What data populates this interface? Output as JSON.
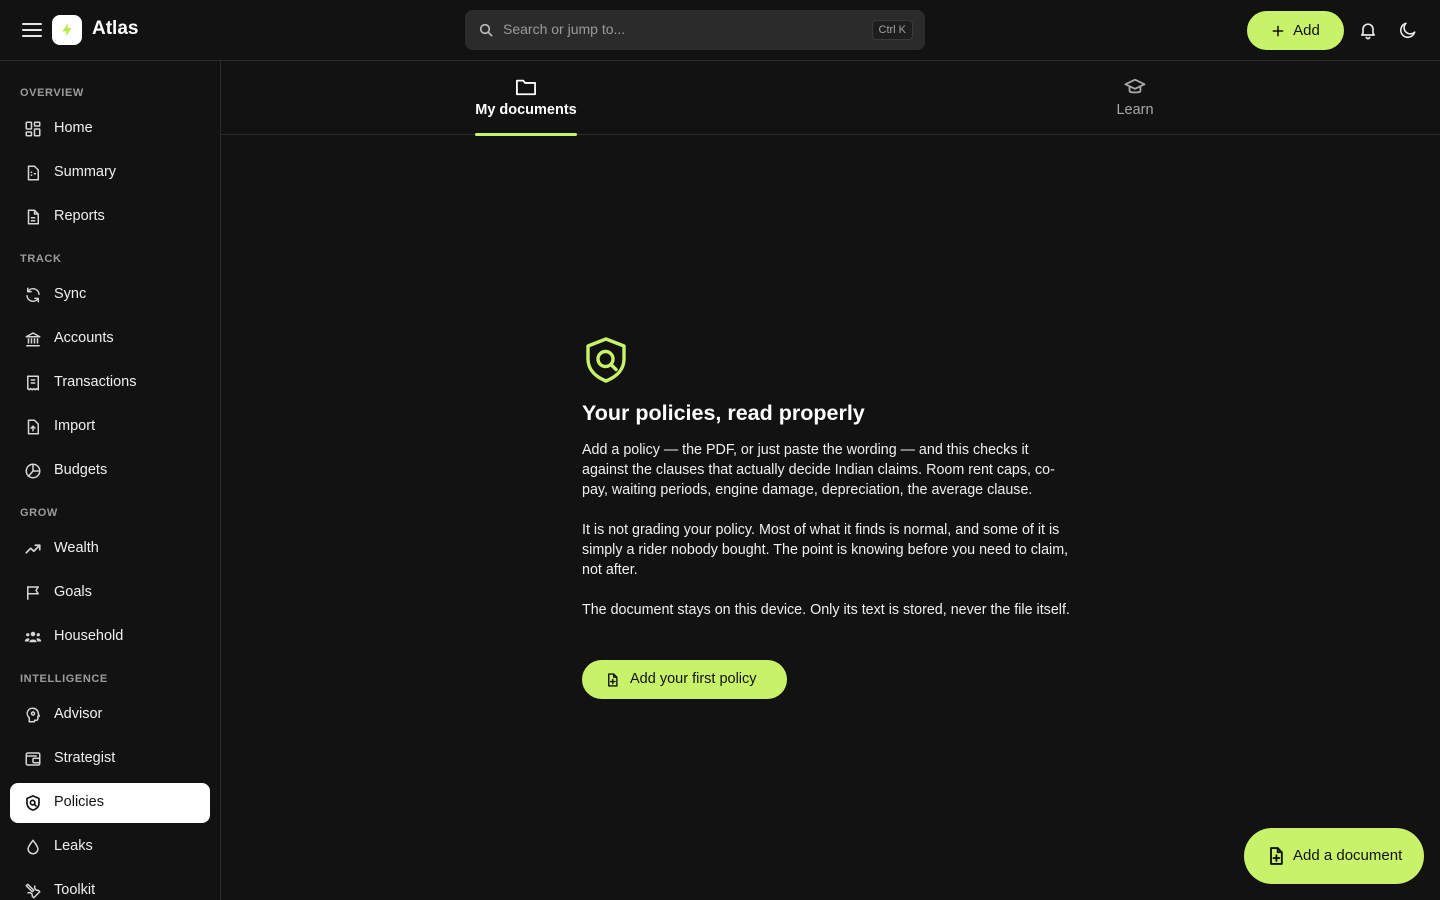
{
  "app": {
    "title": "Atlas",
    "accent_color": "#c9f26b",
    "background_color": "#121212"
  },
  "header": {
    "search_placeholder": "Search or jump to...",
    "search_shortcut": "Ctrl K",
    "add_label": "Add",
    "icons": [
      "menu-icon",
      "bolt-icon",
      "search-icon",
      "plus-icon",
      "bell-icon",
      "moon-icon"
    ]
  },
  "sidebar": {
    "sections": {
      "overview": "OVERVIEW",
      "track": "TRACK",
      "grow": "GROW",
      "intelligence": "INTELLIGENCE"
    },
    "items": [
      {
        "label": "Home",
        "icon": "grid-icon"
      },
      {
        "label": "Summary",
        "icon": "summary-icon"
      },
      {
        "label": "Reports",
        "icon": "document-icon"
      },
      {
        "label": "Sync",
        "icon": "sync-icon"
      },
      {
        "label": "Accounts",
        "icon": "bank-icon"
      },
      {
        "label": "Transactions",
        "icon": "receipt-icon"
      },
      {
        "label": "Import",
        "icon": "upload-file-icon"
      },
      {
        "label": "Budgets",
        "icon": "pie-icon"
      },
      {
        "label": "Wealth",
        "icon": "trend-icon"
      },
      {
        "label": "Goals",
        "icon": "flag-icon"
      },
      {
        "label": "Household",
        "icon": "people-icon"
      },
      {
        "label": "Advisor",
        "icon": "advisor-icon"
      },
      {
        "label": "Strategist",
        "icon": "strategist-icon"
      },
      {
        "label": "Policies",
        "icon": "shield-icon",
        "active": true
      },
      {
        "label": "Leaks",
        "icon": "drop-icon"
      },
      {
        "label": "Toolkit",
        "icon": "tools-icon"
      }
    ]
  },
  "tabs": [
    {
      "label": "My documents",
      "icon": "folder-icon",
      "active": true
    },
    {
      "label": "Learn",
      "icon": "graduation-cap-icon",
      "active": false
    }
  ],
  "empty_state": {
    "icon": "shield-search-icon",
    "title": "Your policies, read properly",
    "paragraphs": [
      "Add a policy — the PDF, or just paste the wording — and this checks it against the clauses that actually decide Indian claims. Room rent caps, co-pay, waiting periods, engine damage, depreciation, the average clause.",
      "It is not grading your policy. Most of what it finds is normal, and some of it is simply a rider nobody bought. The point is knowing before you need to claim, not after.",
      "The document stays on this device. Only its text is stored, never the file itself."
    ],
    "button_label": "Add your first policy"
  },
  "fab": {
    "label": "Add a document",
    "icon": "file-plus-icon"
  }
}
